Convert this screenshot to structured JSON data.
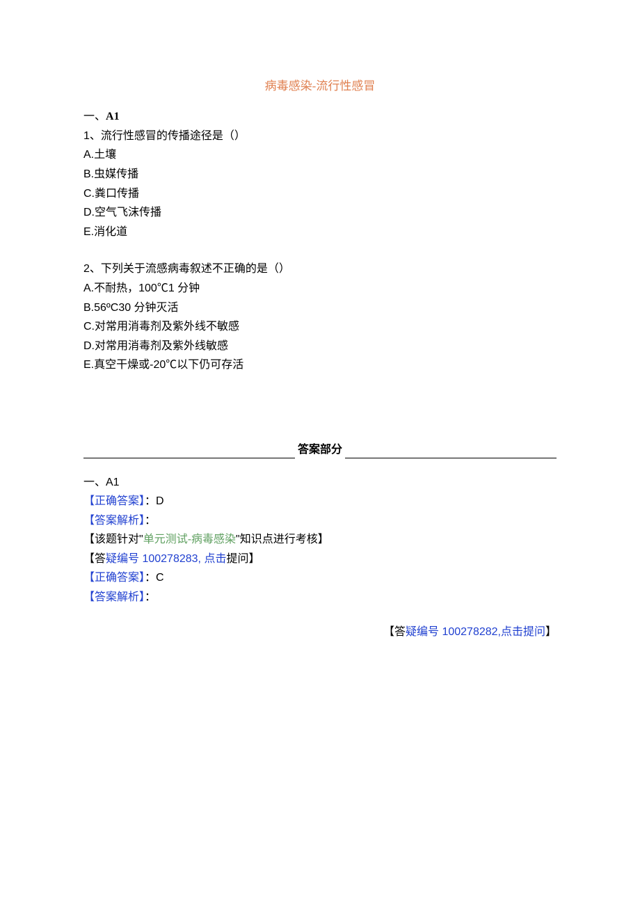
{
  "title": "病毒感染-流行性感冒",
  "section1": {
    "heading_prefix": "一、",
    "heading_code": "A1",
    "q1": {
      "text": "1、流行性感冒的传播途径是（）",
      "opts": {
        "A": "A.土壤",
        "B": "B.虫媒传播",
        "C": "C.粪口传播",
        "D": "D.空气飞沫传播",
        "E": "E.消化道"
      }
    },
    "q2": {
      "text": "2、下列关于流感病毒叙述不正确的是（）",
      "opts": {
        "A": "A.不耐热，100℃1 分钟",
        "B": "B.56ºC30 分钟灭活",
        "C": "C.对常用消毒剂及紫外线不敏感",
        "D": "D.对常用消毒剂及紫外线敏感",
        "E": "E.真空干燥或-20℃以下仍可存活"
      }
    }
  },
  "answer_header": "答案部分",
  "answers": {
    "heading": "一、A1",
    "a1": {
      "correct_label": "【正确答案】",
      "correct_value": "：D",
      "analysis_label": "【答案解析】",
      "analysis_value": "：",
      "note_prefix": "【该题针对\"",
      "note_green": "单元测试-病毒感染",
      "note_suffix": "\"知识点进行考核】",
      "qid_prefix": "【答",
      "qid_blue_part": "疑编号 100278283, 点击",
      "qid_suffix": "提问】"
    },
    "a2": {
      "correct_label": "【正确答案】",
      "correct_value": "：C",
      "analysis_label": "【答案解析】",
      "analysis_value": "："
    },
    "right_note": {
      "prefix": "【答",
      "blue": "疑编号 100278282,点击提问",
      "suffix": "】"
    }
  }
}
